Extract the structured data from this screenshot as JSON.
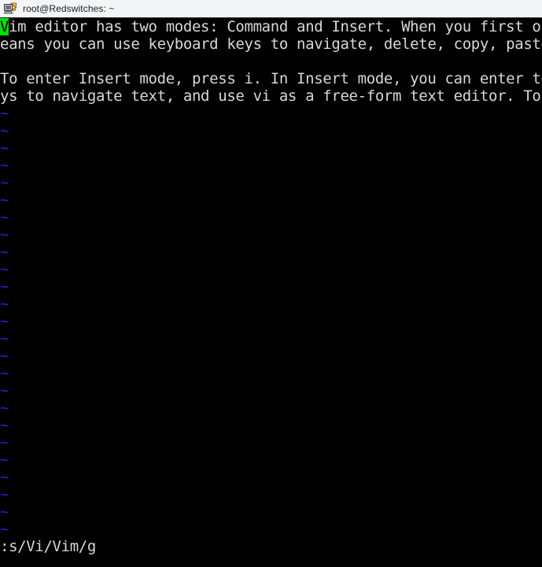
{
  "window": {
    "title": "root@Redswitches: ~",
    "icon": "putty-icon",
    "titlebar_bg": "#f4f5f7",
    "titlebar_fg": "#1a1a1a"
  },
  "terminal": {
    "background": "#000000",
    "foreground": "#d8d8d8",
    "tilde_color": "#2222d8",
    "cursor_color": "#00e000",
    "cursor_text_color": "#000000",
    "cursor_char": "V",
    "cols_visible": 57,
    "rows_visible": 31,
    "lines": [
      {
        "type": "text-cursor",
        "cursor": "V",
        "rest": "im editor has two modes: Command and Insert. When you first op"
      },
      {
        "type": "text",
        "content": "eans you can use keyboard keys to navigate, delete, copy, paste"
      },
      {
        "type": "blank",
        "content": ""
      },
      {
        "type": "text",
        "content": "To enter Insert mode, press i. In Insert mode, you can enter te"
      },
      {
        "type": "text",
        "content": "ys to navigate text, and use vi as a free-form text editor. To "
      }
    ],
    "tilde": "~",
    "tilde_count": 25,
    "status_line": ":s/Vi/Vim/g"
  }
}
